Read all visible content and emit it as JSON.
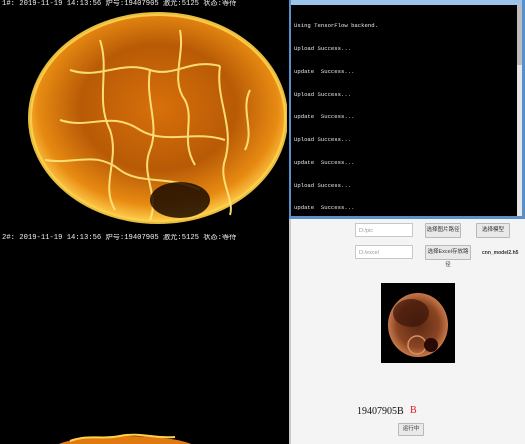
{
  "camera1": {
    "header": "1#: 2019-11-19 14:13:56   炉号:19407905   激光:5125   状态:等待"
  },
  "camera2": {
    "header": "2#: 2019-11-19 14:13:56   炉号:19407905   激光:5125   状态:等待"
  },
  "console": {
    "lines": [
      "Using TensorFlow backend.",
      "Upload Success...",
      "update  Success...",
      "Upload Success...",
      "update  Success...",
      "Upload Success...",
      "update  Success...",
      "Upload Success...",
      "update  Success..."
    ]
  },
  "form": {
    "image_path_placeholder": "D:/pic",
    "excel_path_placeholder": "D:/excel",
    "select_image_button": "选择图片路径",
    "select_model_button": "选择模型",
    "select_excel_button": "选择Excel存放路径",
    "model_name": "cnn_model2.h5",
    "result_id": "19407905B",
    "result_grade": "B",
    "run_button": "运行中"
  }
}
